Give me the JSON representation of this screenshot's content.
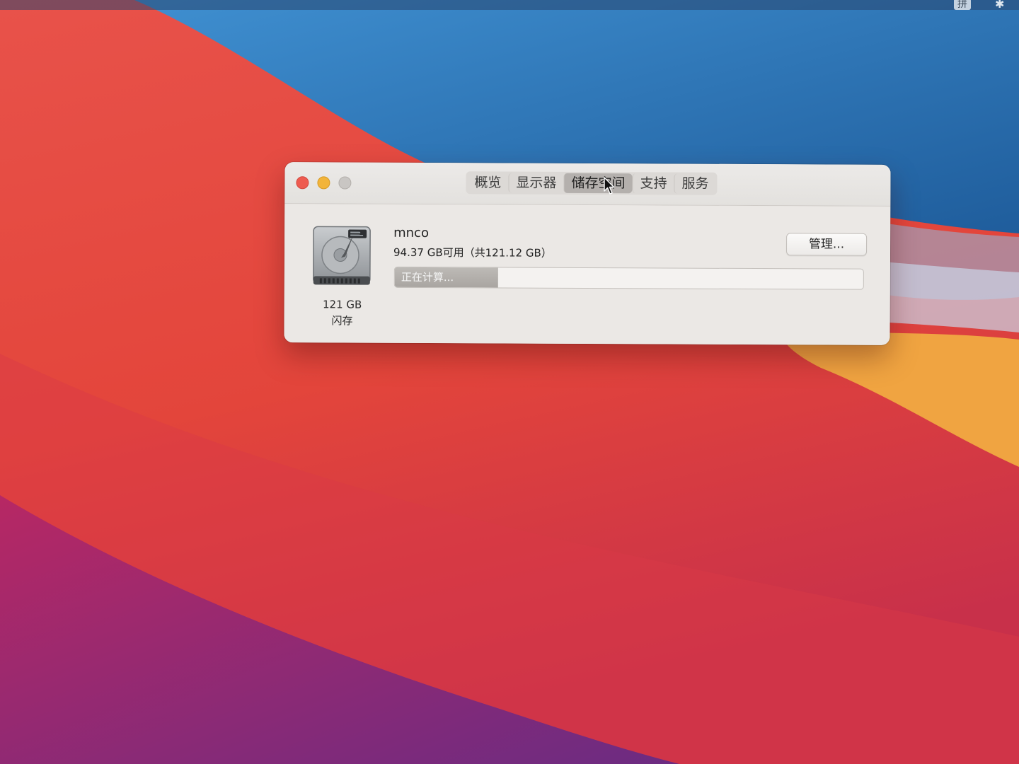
{
  "menubar": {
    "input_method": "拼",
    "bluetooth_icon": "bluetooth-icon"
  },
  "window": {
    "tabs": [
      {
        "label": "概览",
        "selected": false
      },
      {
        "label": "显示器",
        "selected": false
      },
      {
        "label": "储存空间",
        "selected": true
      },
      {
        "label": "支持",
        "selected": false
      },
      {
        "label": "服务",
        "selected": false
      }
    ]
  },
  "storage": {
    "drive_icon": "hard-drive-icon",
    "drive_size": "121 GB",
    "drive_type": "闪存",
    "volume_name": "mnco",
    "availability": "94.37 GB可用（共121.12 GB）",
    "manage_label": "管理...",
    "bar_status": "正在计算...",
    "bar_fill_fraction": 0.22
  },
  "colors": {
    "close": "#ee5b50",
    "minimize": "#f2b43a",
    "zoom_disabled": "#c9c6c3"
  }
}
